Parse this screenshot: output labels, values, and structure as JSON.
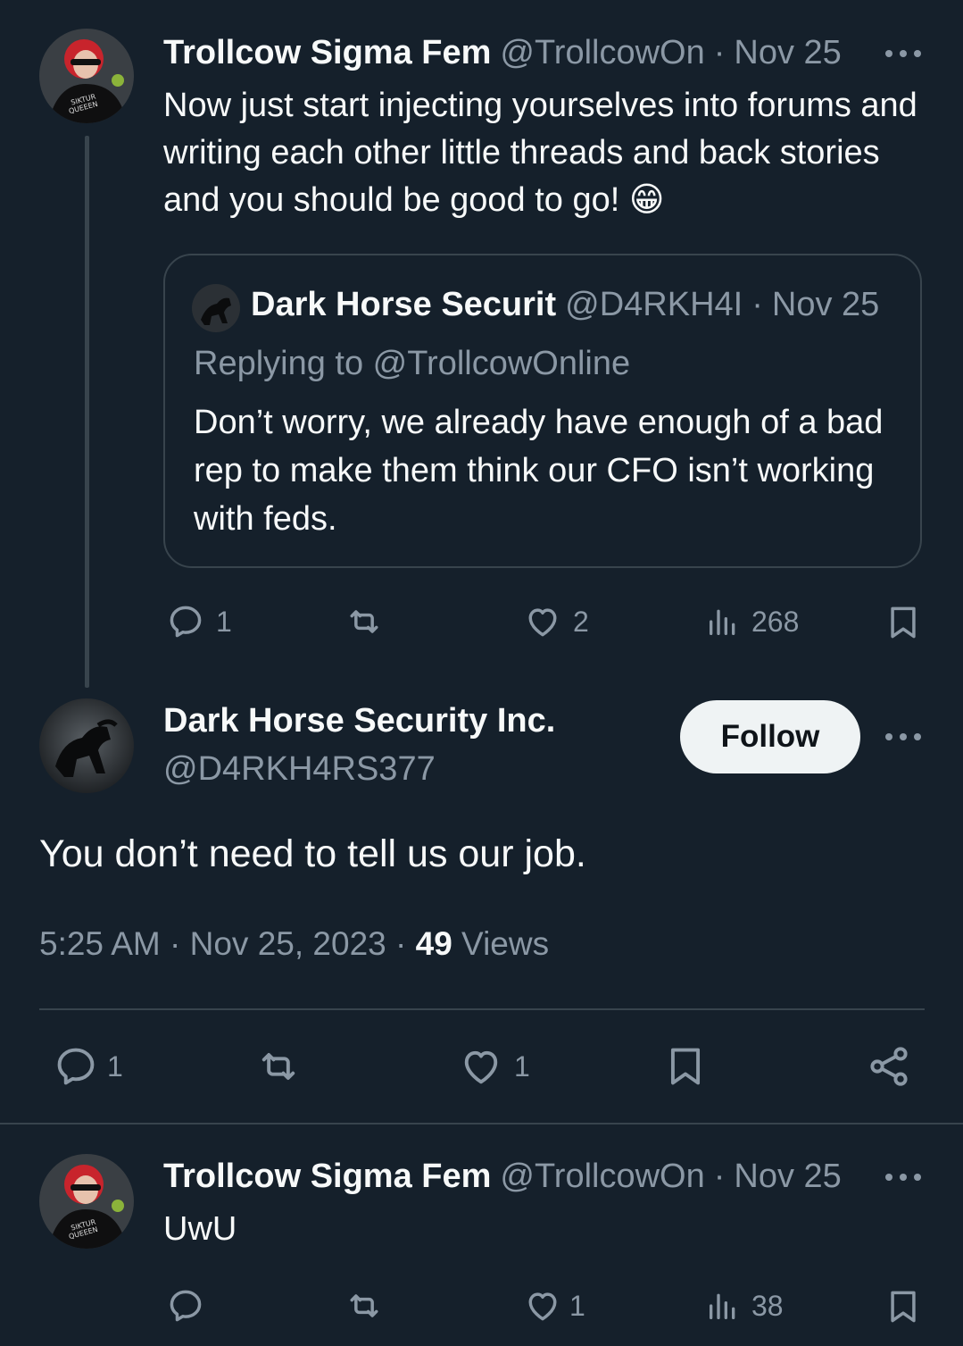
{
  "tweet1": {
    "name": "Trollcow Sigma Fem",
    "handle": "@TrollcowOn",
    "dot": "·",
    "date": "Nov 25",
    "text": "Now just start injecting yourselves into forums and writing each other little threads and back stories and you should be good to go!",
    "emoji": "😁",
    "avatar_text": "SIKTUR QUEEEN",
    "quote": {
      "name": "Dark Horse Securit",
      "handle": "@D4RKH4I",
      "dot": "·",
      "date": "Nov 25",
      "replying": "Replying to @TrollcowOnline",
      "text": "Don’t worry, we already have enough of a bad rep to make them think our CFO isn’t working with feds."
    },
    "actions": {
      "reply_count": "1",
      "retweet_count": "",
      "like_count": "2",
      "views_count": "268"
    }
  },
  "main_tweet": {
    "name": "Dark Horse Security Inc.",
    "handle": "@D4RKH4RS377",
    "follow_label": "Follow",
    "text": "You don’t need to tell us our job.",
    "timestamp": "5:25 AM · Nov 25, 2023 · ",
    "views_count": "49",
    "views_label": " Views",
    "actions": {
      "reply_count": "1",
      "like_count": "1"
    }
  },
  "reply_tweet": {
    "name": "Trollcow Sigma Fem",
    "handle": "@TrollcowOn",
    "dot": "·",
    "date": "Nov 25",
    "text": "UwU",
    "avatar_text": "SIKTUR QUEEEN",
    "actions": {
      "reply_count": "",
      "like_count": "1",
      "views_count": "38"
    }
  },
  "colors": {
    "background": "#15202b",
    "muted": "#8b98a5",
    "text": "#f7f9f9",
    "divider": "#38444d",
    "follow_bg": "#eff3f4",
    "avatar_hair": "#d0222a"
  },
  "icons": [
    "reply-icon",
    "retweet-icon",
    "like-icon",
    "views-icon",
    "bookmark-icon",
    "share-icon",
    "more-icon"
  ]
}
